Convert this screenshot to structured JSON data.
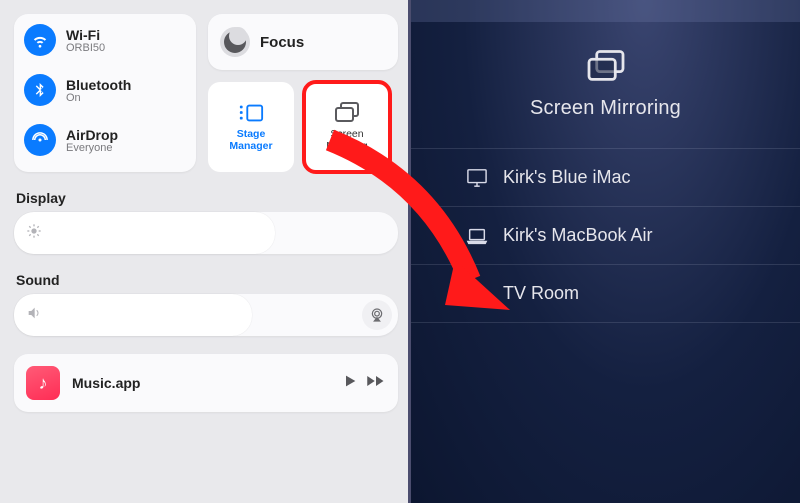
{
  "conn": {
    "wifi": {
      "title": "Wi-Fi",
      "sub": "ORBI50"
    },
    "bluetooth": {
      "title": "Bluetooth",
      "sub": "On"
    },
    "airdrop": {
      "title": "AirDrop",
      "sub": "Everyone"
    }
  },
  "focus": {
    "label": "Focus"
  },
  "tiles": {
    "stage": "Stage\nManager",
    "mirror": "Screen\nMirroring"
  },
  "sections": {
    "display": "Display",
    "sound": "Sound"
  },
  "music": {
    "app": "Music.app"
  },
  "mirroring": {
    "title": "Screen Mirroring",
    "devices": [
      {
        "name": "Kirk's Blue iMac",
        "type": "desktop"
      },
      {
        "name": "Kirk's MacBook Air",
        "type": "laptop"
      },
      {
        "name": "TV Room",
        "type": "appletv"
      }
    ]
  },
  "slider": {
    "display_pct": 68,
    "sound_pct": 62
  }
}
